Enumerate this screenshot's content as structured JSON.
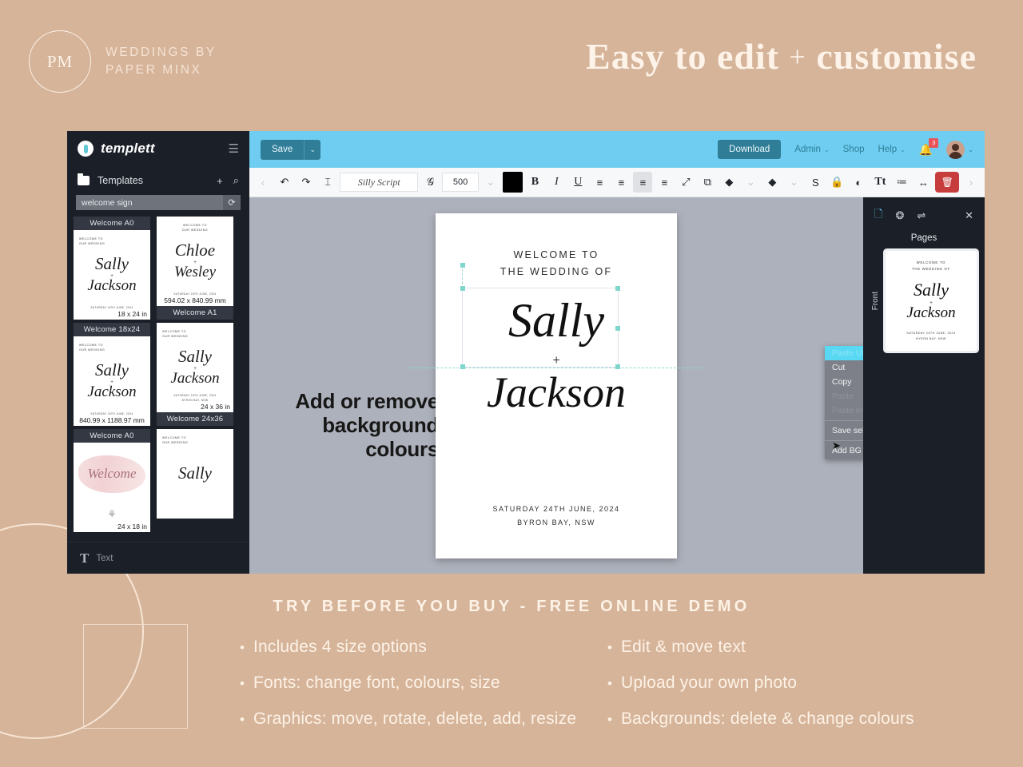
{
  "brand": {
    "mark": "PM",
    "line1": "WEDDINGS BY",
    "line2": "PAPER MINX"
  },
  "headline": {
    "part1": "Easy to edit",
    "plus": "+",
    "part2": "customise"
  },
  "sidebar": {
    "app_name": "templett",
    "menu_icon": "☰",
    "section_label": "Templates",
    "add_icon": "+",
    "search_icon": "⌕",
    "search_value": "welcome sign",
    "search_placeholder": "welcome sign",
    "refresh_icon": "⟳",
    "thumbs": [
      {
        "caption": "Welcome A0",
        "cap_pos": "top",
        "top": "WELCOME TO\nOUR WEDDING",
        "top_align": "left",
        "name1": "Sally",
        "amp": "+",
        "name2": "Jackson",
        "bottom": "SATURDAY 24TH JUNE, 2024",
        "dim": "18 x 24 in",
        "dim_wide": false,
        "style": "plain"
      },
      {
        "caption": "Welcome A1",
        "cap_pos": "bottom",
        "top": "WELCOME TO\nOUR WEDDING",
        "top_align": "center",
        "name1": "Chloe",
        "amp": "+",
        "name2": "Wesley",
        "bottom": "SATURDAY 24TH JUNE, 2024",
        "dim": "594.02 x 840.99 mm",
        "dim_wide": true,
        "style": "plain"
      },
      {
        "caption": "Welcome 18x24",
        "cap_pos": "top",
        "top": "WELCOME TO\nOUR WEDDING",
        "top_align": "left",
        "name1": "Sally",
        "amp": "+",
        "name2": "Jackson",
        "bottom": "SATURDAY 24TH JUNE, 2024",
        "dim": "840.99 x 1188.97 mm",
        "dim_wide": true,
        "style": "plain"
      },
      {
        "caption": "Welcome 24x36",
        "cap_pos": "bottom",
        "top": "WELCOME TO\nOUR WEDDING",
        "top_align": "left",
        "name1": "Sally",
        "amp": "+",
        "name2": "Jackson",
        "bottom": "SATURDAY 24TH JUNE, 2024\nBYRON BAY, NSW",
        "dim": "24 x 36 in",
        "dim_wide": false,
        "style": "plain"
      },
      {
        "caption": "Welcome A0",
        "cap_pos": "top",
        "top": "",
        "top_align": "left",
        "name1": "",
        "amp": "",
        "name2": "",
        "bottom": "",
        "dim": "24 x 18 in",
        "dim_wide": false,
        "style": "wash",
        "wash_word": "Welcome"
      },
      {
        "caption": "",
        "cap_pos": "none",
        "top": "WELCOME TO\nOUR WEDDING",
        "top_align": "left",
        "name1": "Sally",
        "amp": "",
        "name2": "",
        "bottom": "",
        "dim": "",
        "dim_wide": false,
        "style": "plain"
      }
    ],
    "footer_glyph": "T",
    "footer_label": "Text"
  },
  "topbar": {
    "save_label": "Save",
    "save_caret": "⌄",
    "download_label": "Download",
    "links": [
      {
        "label": "Admin",
        "caret": "⌄"
      },
      {
        "label": "Shop",
        "caret": ""
      },
      {
        "label": "Help",
        "caret": "⌄"
      }
    ],
    "bell_icon": "🔔",
    "bell_badge": "3",
    "avatar_caret": "⌄"
  },
  "toolbar": {
    "prev_icon": "‹",
    "undo_icon": "↶",
    "redo_icon": "↷",
    "text_tool_icon": "⌶",
    "font_name": "Silly Script",
    "font_style_icon": "𝒢",
    "font_size": "500",
    "size_caret": "⌄",
    "color_swatch": "#000000",
    "bold": "B",
    "italic": "I",
    "underline": "U",
    "align_left": "≡",
    "align_center": "≡",
    "align_right": "≡",
    "align_justify": "≡",
    "resize_icon": "⤢",
    "duplicate_icon": "⧉",
    "layer_up_icon": "◆",
    "layer_up_caret": "⌄",
    "layer_down_icon": "◆",
    "layer_down_caret": "⌄",
    "shadow_icon": "S",
    "lock_icon": "🔒",
    "opacity_icon": "◐",
    "case_icon": "Tt",
    "line_spacing_icon": "≔",
    "letter_spacing_icon": "↔",
    "delete_icon": "🗑",
    "next_icon": "›"
  },
  "canvas": {
    "page": {
      "welcome_line1": "WELCOME TO",
      "welcome_line2": "THE WEDDING OF",
      "name1": "Sally",
      "amp": "+",
      "name2": "Jackson",
      "foot_line1": "SATURDAY 24TH JUNE, 2024",
      "foot_line2": "BYRON BAY, NSW"
    },
    "overlay_note": "Add or remove background colours",
    "context_menu": {
      "items": [
        {
          "label": "Paste URL",
          "state": "selected"
        },
        {
          "label": "Cut",
          "state": "normal"
        },
        {
          "label": "Copy",
          "state": "normal"
        },
        {
          "label": "Paste",
          "state": "disabled"
        },
        {
          "label": "Paste in place",
          "state": "disabled"
        },
        {
          "label": "Save selection",
          "state": "normal"
        },
        {
          "label": "Add BG color",
          "state": "normal"
        }
      ],
      "cursor_icon": "➤"
    }
  },
  "right_panel": {
    "icons": [
      {
        "name": "pages-icon",
        "glyph": "🗋",
        "active": true
      },
      {
        "name": "layers-icon",
        "glyph": "❂",
        "active": false
      },
      {
        "name": "settings-icon",
        "glyph": "⇌",
        "active": false
      }
    ],
    "close_icon": "✕",
    "title": "Pages",
    "page_label": "Front",
    "thumb": {
      "top_line1": "WELCOME TO",
      "top_line2": "THE WEDDING OF",
      "name1": "Sally",
      "amp": "+",
      "name2": "Jackson",
      "bot_line1": "SATURDAY 24TH JUNE, 2024",
      "bot_line2": "BYRON BAY, NSW"
    }
  },
  "promo": {
    "title": "TRY BEFORE YOU BUY - FREE ONLINE DEMO",
    "bullet": "•",
    "rows": [
      [
        "Includes 4 size options",
        "Edit & move text"
      ],
      [
        "Fonts: change font, colours, size",
        "Upload your own photo"
      ],
      [
        "Graphics: move, rotate, delete, add, resize",
        "Backgrounds: delete & change colours"
      ]
    ]
  }
}
